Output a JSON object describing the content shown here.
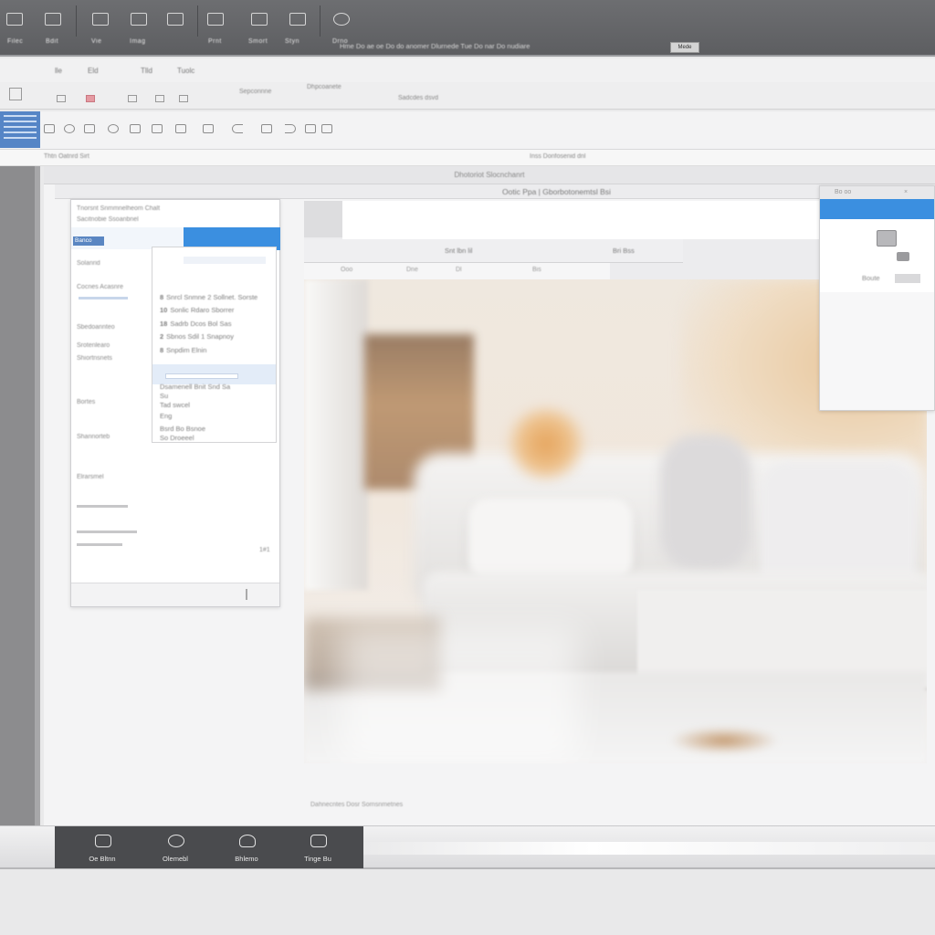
{
  "colors": {
    "toolbar_dark": "#5d5e61",
    "accent_blue": "#3b8fe0",
    "selection_blue": "#5a86c2",
    "background": "#e9e9ea"
  },
  "top_toolbar": {
    "buttons": [
      {
        "icon": "layout-icon",
        "label": "Filec"
      },
      {
        "icon": "image-icon",
        "label": "Bdit"
      },
      {
        "icon": "grid-icon",
        "label": "Vie"
      },
      {
        "icon": "frame-icon",
        "label": "Imag"
      },
      {
        "icon": "film-icon",
        "label": "Prnt"
      },
      {
        "icon": "folder-icon",
        "label": "Smort"
      },
      {
        "icon": "window-icon",
        "label": "Styn"
      },
      {
        "icon": "settings-icon",
        "label": "Drno"
      }
    ],
    "status": "Hme  Do ae oe Do do anomer Dlurnede Tue Do nar Do nudiare",
    "action_button": "Mede"
  },
  "ribbon": {
    "tabs": [
      "lle",
      "Eld",
      "Tlld",
      "Tuolc"
    ],
    "row2": {
      "items": [
        "Sepconnne",
        "Dhpcoanete",
        "Sadcdes dsvd"
      ]
    }
  },
  "search_row": {
    "left": "Thtn Oatnrd Sirt",
    "middle": "Inss Donfosenid dnl"
  },
  "main_window": {
    "title": "Dhotoriot  Slocnchanrt",
    "document_title": "Ootic Ppa | Gborbotonemtsl Bsi"
  },
  "left_dialog": {
    "header1": "Tnorsnt  Snmmnelheom  Chalt",
    "header2": "Sacitnobie Ssoanbnel",
    "selected": "Banco",
    "rows": [
      "Solanrid",
      "Cocnes Acasnre",
      "Sbedoannteo",
      "Srotenlearo",
      "Shiortnsnets",
      "Bortes",
      "Shannorteb",
      "Elrarsmel"
    ],
    "submenu": {
      "items": [
        {
          "key": "8",
          "text": "Snrcl Snmne 2 Sollnet. Sorste"
        },
        {
          "key": "10",
          "text": "Sonlic  Rdaro Sborrer"
        },
        {
          "key": "18",
          "text": "Sadrb  Dcos Bol Sas"
        },
        {
          "key": "2",
          "text": "Sbnos  Sdil 1 Snapnoy"
        },
        {
          "key": "8",
          "text": "Snpdim  Elnin"
        }
      ],
      "lower": [
        "Dsamenell Bnit Snd Sa",
        "Su",
        "Tad swcel",
        "Eng",
        "Bsrd Bo Bsnoe",
        "So Droeeel"
      ]
    },
    "footer_count": "1#1"
  },
  "photo_viewer": {
    "window_title": "Snt lbn lil",
    "window_right": "Bri Bss",
    "toolbar": [
      "Ooo",
      "Dne",
      "Dl",
      "Bis"
    ],
    "caption": "Dahnecntes Dosr Sornsnmetnes"
  },
  "right_dialog": {
    "title": "Bo oo",
    "label": "Boute",
    "icon": "printer-icon"
  },
  "dock": {
    "items": [
      {
        "icon": "monitor-icon",
        "label": "Oe Bltnn"
      },
      {
        "icon": "globe-icon",
        "label": "Olemebl"
      },
      {
        "icon": "user-icon",
        "label": "Bhlemo"
      },
      {
        "icon": "display-icon",
        "label": "Tinge Bu"
      }
    ]
  }
}
